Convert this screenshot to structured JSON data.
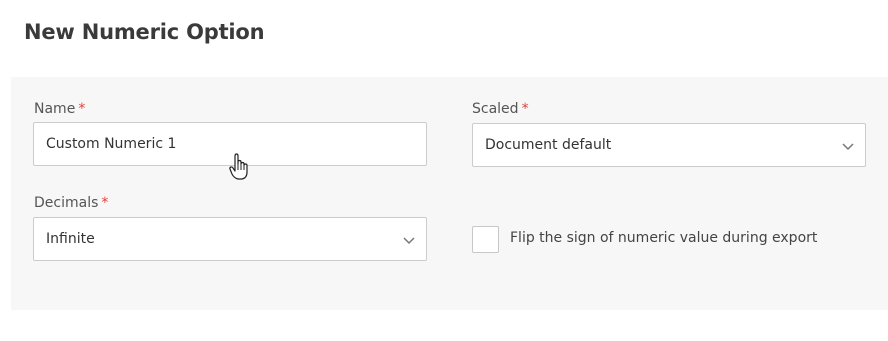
{
  "page": {
    "title": "New Numeric Option"
  },
  "form": {
    "name": {
      "label": "Name",
      "required_mark": "*",
      "value": "Custom Numeric 1"
    },
    "scaled": {
      "label": "Scaled",
      "required_mark": "*",
      "value": "Document default"
    },
    "decimals": {
      "label": "Decimals",
      "required_mark": "*",
      "value": "Infinite"
    },
    "flip_sign": {
      "label": "Flip the sign of numeric value during export",
      "checked": false
    }
  },
  "icons": {
    "dropdown": "chevron-down-icon",
    "cursor": "hand-pointer-icon"
  },
  "colors": {
    "required": "#e0413a",
    "panel_background": "#f7f7f7",
    "border": "#cccccc"
  }
}
